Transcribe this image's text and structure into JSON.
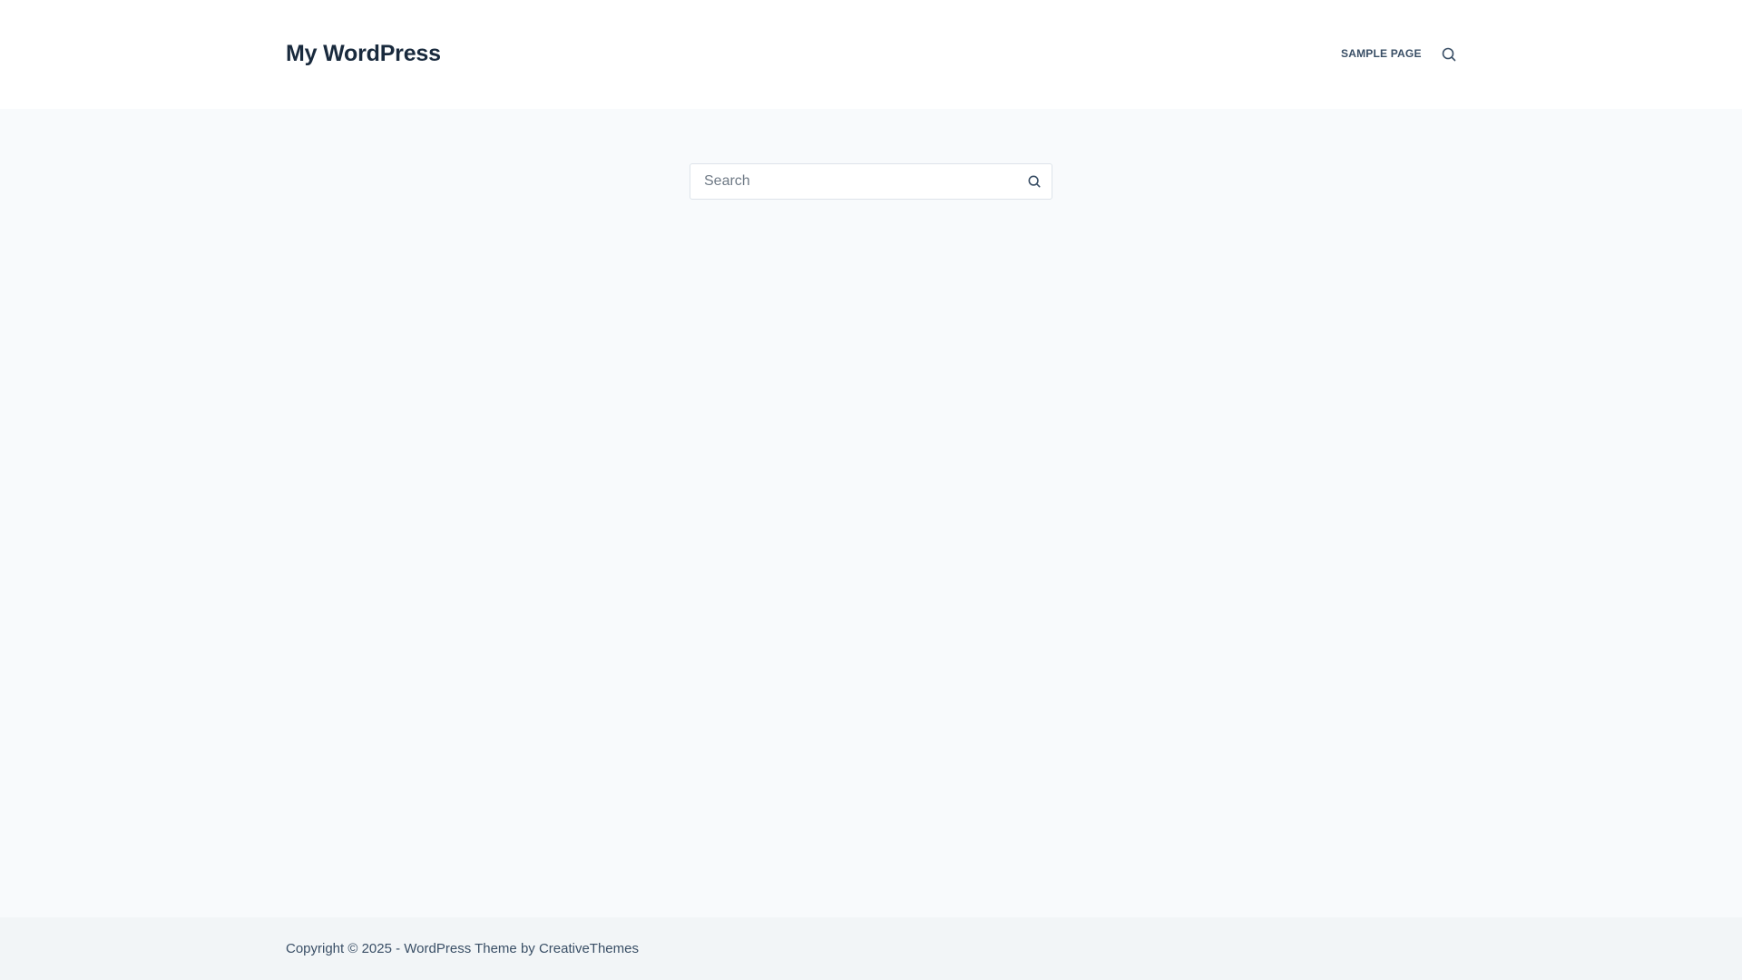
{
  "header": {
    "site_title": "My WordPress",
    "nav": [
      {
        "label": "SAMPLE PAGE"
      }
    ],
    "search_toggle_icon": "search-icon"
  },
  "main": {
    "search": {
      "placeholder": "Search",
      "value": "",
      "submit_icon": "search-icon"
    }
  },
  "footer": {
    "copyright": "Copyright © 2025 - WordPress Theme by CreativeThemes"
  },
  "colors": {
    "title": "#192a3d",
    "text": "#3a4f66",
    "background": "#f8fafc",
    "footer_background": "#f2f5f7"
  }
}
